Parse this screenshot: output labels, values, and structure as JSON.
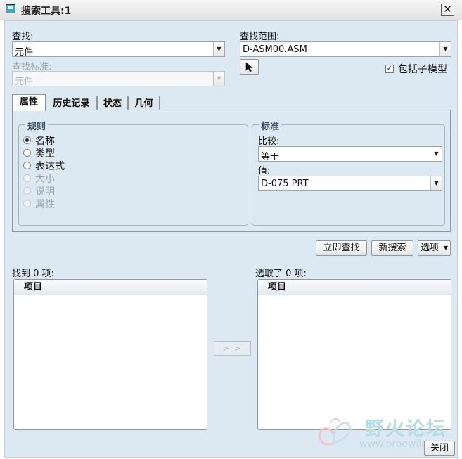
{
  "window": {
    "title": "搜索工具:1",
    "close_glyph": "✕"
  },
  "search": {
    "find_label": "查找:",
    "find_value": "元件",
    "criteria_label": "查找标准:",
    "criteria_value": "元件",
    "scope_label": "查找范围:",
    "scope_value": "D-ASM00.ASM",
    "include_submodels_label": "包括子模型",
    "include_submodels_checked": true
  },
  "tabs": [
    {
      "label": "属性",
      "active": true
    },
    {
      "label": "历史记录",
      "active": false
    },
    {
      "label": "状态",
      "active": false
    },
    {
      "label": "几何",
      "active": false
    }
  ],
  "rules": {
    "title": "规则",
    "options": [
      {
        "label": "名称",
        "checked": true,
        "enabled": true
      },
      {
        "label": "类型",
        "checked": false,
        "enabled": true
      },
      {
        "label": "表达式",
        "checked": false,
        "enabled": true
      },
      {
        "label": "大小",
        "checked": false,
        "enabled": false
      },
      {
        "label": "说明",
        "checked": false,
        "enabled": false
      },
      {
        "label": "属性",
        "checked": false,
        "enabled": false
      }
    ]
  },
  "criteria": {
    "title": "标准",
    "compare_label": "比较:",
    "compare_value": "等于",
    "value_label": "值:",
    "value_value": "D-075.PRT"
  },
  "actions": {
    "find_now": "立即查找",
    "new_search": "新搜索",
    "options": "选项"
  },
  "results": {
    "found_label": "找到 0 项:",
    "found_column": "项目",
    "selected_label": "选取了 0 项:",
    "selected_column": "项目",
    "transfer_label": "> >"
  },
  "footer": {
    "close_label": "关闭"
  },
  "watermark": {
    "title": "野火论坛",
    "url": "www.proewild"
  },
  "colors": {
    "client_bg": "#dde9f2",
    "titlebar_bg": "#ececec",
    "accent": "#3fa7c9"
  },
  "icons": {
    "pointer": "cursor-arrow-icon",
    "dropdown": "chevron-down-icon"
  }
}
